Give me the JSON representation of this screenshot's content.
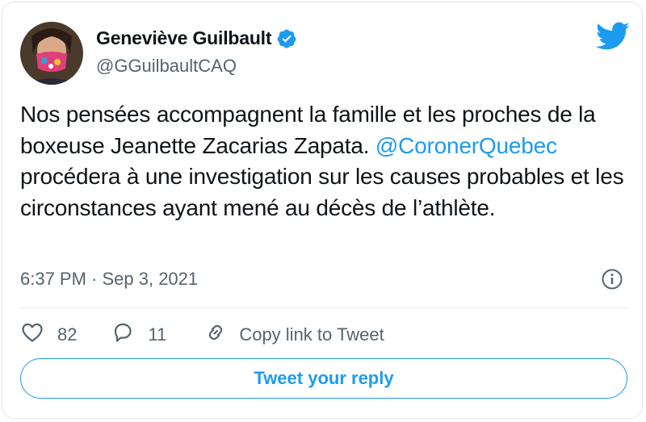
{
  "author": {
    "name": "Geneviève Guilbault",
    "handle": "@GGuilbaultCAQ",
    "verified": true
  },
  "tweet": {
    "text_parts": [
      "Nos pensées accompagnent la famille et les proches de la boxeuse Jeanette Zacarias Zapata. ",
      "@CoronerQuebec",
      " procédera à une investigation sur les causes probables et les circonstances ayant mené au décès de l’athlète."
    ],
    "timestamp": "6:37 PM · Sep 3, 2021"
  },
  "actions": {
    "likes": "82",
    "replies": "11",
    "copy_link_label": "Copy link to Tweet"
  },
  "reply_button_label": "Tweet your reply",
  "colors": {
    "accent": "#1d9bf0",
    "text": "#0f1419",
    "secondary": "#536471",
    "border": "#e1e8ed"
  },
  "icons": [
    "twitter-bird-icon",
    "verified-badge-icon",
    "info-icon",
    "heart-icon",
    "reply-icon",
    "link-icon"
  ]
}
